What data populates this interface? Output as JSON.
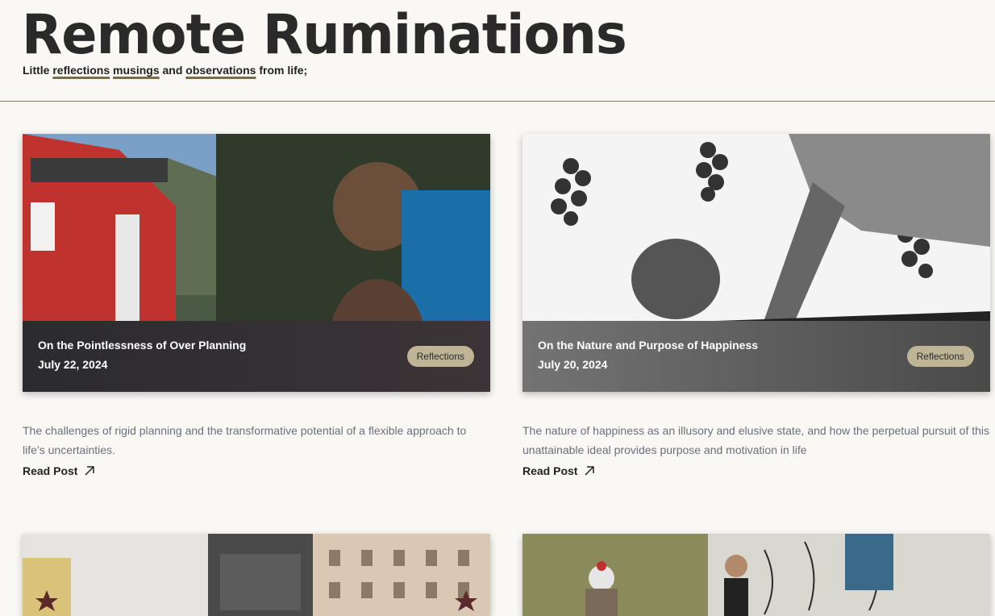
{
  "site": {
    "title": "Remote Ruminations",
    "tagline": {
      "prefix": "Little ",
      "word1": "reflections",
      "word2": "musings",
      "and": " and ",
      "word3": "observations",
      "suffix": " from life;"
    }
  },
  "posts": [
    {
      "title": "On the Pointlessness of Over Planning",
      "date": "July 22, 2024",
      "category": "Reflections",
      "excerpt": "The challenges of rigid planning and the transformative potential of a flexible approach to life’s uncertainties.",
      "read_label": "Read Post",
      "image": "train-platform-photo"
    },
    {
      "title": "On the Nature and Purpose of Happiness",
      "date": "July 20, 2024",
      "category": "Reflections",
      "excerpt": "The nature of happiness as an illusory and elusive state, and how the perpetual pursuit of this unattainable ideal provides purpose and motivation in life",
      "read_label": "Read Post",
      "image": "grapes-reaching-illustration"
    },
    {
      "image": "city-monument-photo"
    },
    {
      "image": "forest-graffiti-photo"
    }
  ],
  "colors": {
    "background": "#f9f8f5",
    "badge": "#bfb596",
    "underline": "#7a6c48",
    "excerpt": "#6b6f7a"
  },
  "icons": {
    "read_arrow": "arrow-up-right-icon"
  }
}
